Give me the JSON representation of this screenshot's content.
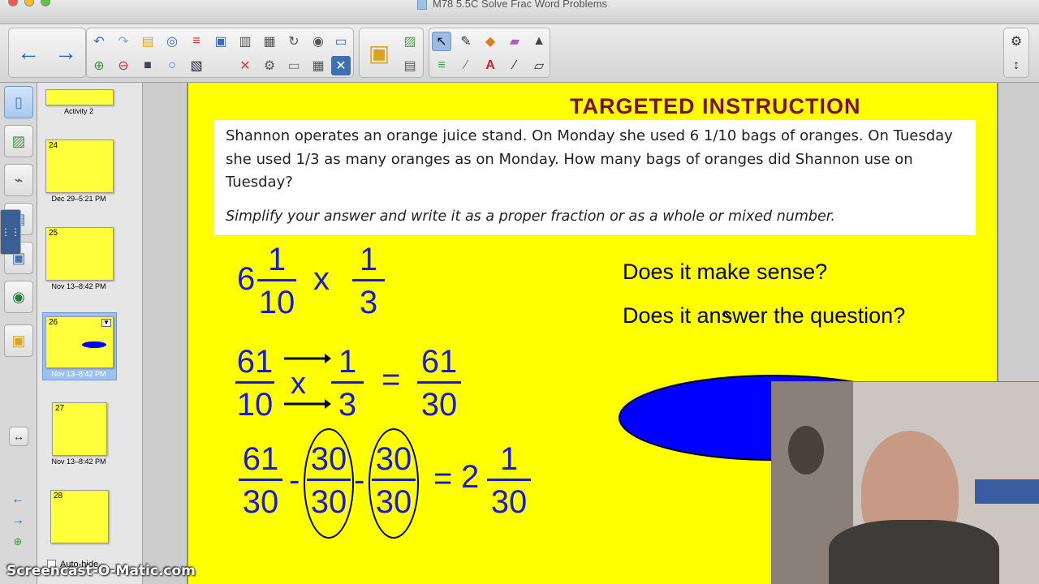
{
  "window": {
    "title": "M78 5.5C Solve Frac Word Problems"
  },
  "sorter": {
    "pages": [
      {
        "caption": "Activity 2"
      },
      {
        "number": "24",
        "caption": "Dec 29–5:21 PM"
      },
      {
        "number": "25",
        "caption": "Nov 13–8:42 PM"
      },
      {
        "number": "26",
        "caption": "Nov 13–8:42 PM"
      },
      {
        "number": "27",
        "caption": "Nov 13–8:42 PM"
      },
      {
        "number": "28",
        "caption": ""
      }
    ],
    "auto_hide_label": "Auto-hide"
  },
  "slide": {
    "title": "TARGETED INSTRUCTION",
    "question": "Shannon operates an orange juice stand. On Monday she used 6 1/10 bags of oranges. On Tuesday she used 1/3 as many oranges as on Monday. How many bags of oranges did Shannon use on Tuesday?",
    "hint": "Simplify your answer and write it as a proper fraction or as a whole or mixed number.",
    "check1": "Does it make sense?",
    "check2": "Does it answer the question?",
    "line1": {
      "whole": "6",
      "num1": "1",
      "den1": "10",
      "op": "x",
      "num2": "1",
      "den2": "3"
    },
    "line2": {
      "num1": "61",
      "den1": "10",
      "op": "x",
      "num2": "1",
      "den2": "3",
      "eq": "=",
      "num3": "61",
      "den3": "30"
    },
    "line3": {
      "num1": "61",
      "den1": "30",
      "minus1": "-",
      "num2": "30",
      "den2": "30",
      "minus2": "-",
      "num3": "30",
      "den3": "30",
      "eq": "=",
      "whole": "2",
      "num4": "1",
      "den4": "30"
    }
  },
  "colors": {
    "slide_bg": "#ffff00",
    "title": "#7a1020",
    "math": "#1a1ad0",
    "ellipse": "#0000ff"
  },
  "watermark": "Screencast-O-Matic.com"
}
